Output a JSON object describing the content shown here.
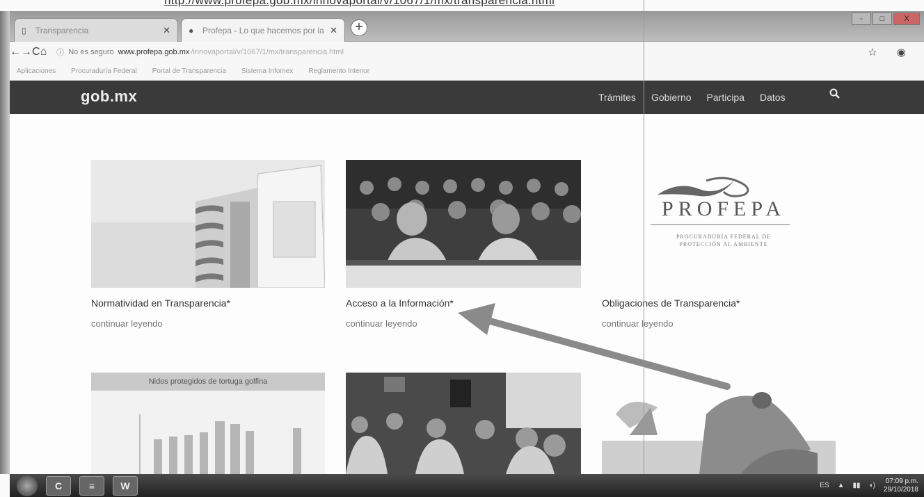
{
  "caption": "http://www.profepa.gob.mx/innovaportal/v/1067/1/mx/transparencia.html",
  "browser": {
    "tabs": [
      {
        "label": "Transparencia",
        "active": false
      },
      {
        "label": "Profepa - Lo que hacemos por la",
        "active": true
      }
    ],
    "newtab_label": "+",
    "window_controls": {
      "minimize": "-",
      "maximize": "□",
      "close": "X"
    },
    "nav": {
      "back": "←",
      "forward": "→",
      "reload": "C",
      "home": "⌂"
    },
    "address": {
      "security_label": "No es seguro",
      "domain": "www.profepa.gob.mx",
      "path": "/innovaportal/v/1067/1/mx/transparencia.html"
    },
    "addr_icons": {
      "star": "☆",
      "extension": "◉",
      "profile": "◐",
      "menu": "⋮"
    },
    "bookmarks": [
      "Aplicaciones",
      "Procuraduría Federal",
      "Portal de Transparencia",
      "Sistema Infomex",
      "Reglamento Interior"
    ]
  },
  "site_nav": {
    "logo": "gob.mx",
    "links": [
      "Trámites",
      "Gobierno",
      "Participa",
      "Datos"
    ],
    "search_icon": "search-icon"
  },
  "cards": [
    {
      "title": "Normatividad en Transparencia*",
      "link": "continuar leyendo"
    },
    {
      "title": "Acceso a la Información*",
      "link": "continuar leyendo"
    },
    {
      "title": "Obligaciones de Transparencia*",
      "link": "continuar leyendo"
    }
  ],
  "profepa_logo": {
    "name": "PROFEPA",
    "subtitle_line1": "PROCURADURÍA FEDERAL DE",
    "subtitle_line2": "PROTECCIÓN AL AMBIENTE"
  },
  "lower_card_banner": "Nidos protegidos de tortuga golfina",
  "taskbar": {
    "apps": [
      "C",
      "≡",
      "W"
    ],
    "tray_lang": "ES",
    "clock_time": "07:09 p.m.",
    "clock_date": "29/10/2018"
  },
  "colors": {
    "nav_bg": "#3a3a3a",
    "page_bg": "#fdfdfd",
    "arrow": "#888888"
  }
}
